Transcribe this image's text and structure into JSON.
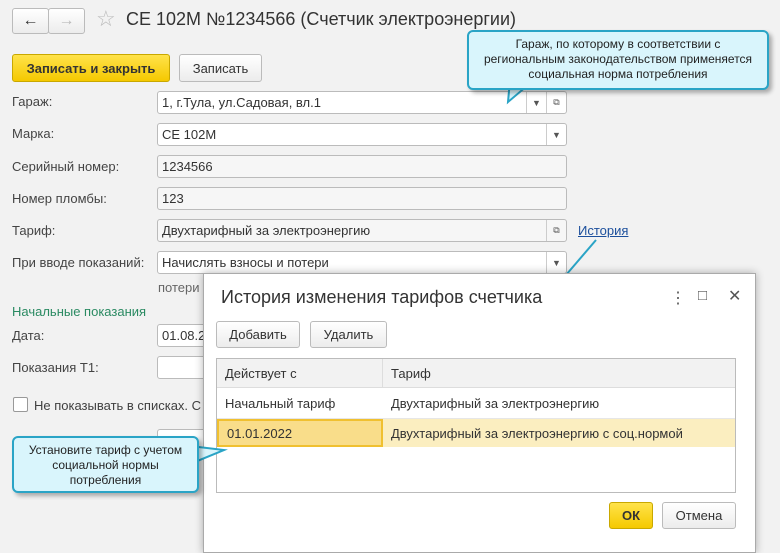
{
  "header": {
    "title": "СЕ 102М №1234566 (Счетчик электроэнергии)"
  },
  "toolbar": {
    "save_close": "Записать и закрыть",
    "save": "Записать"
  },
  "form": {
    "garage_label": "Гараж:",
    "garage_value": "1, г.Тула, ул.Садовая, вл.1",
    "brand_label": "Марка:",
    "brand_value": "СЕ 102М",
    "serial_label": "Серийный номер:",
    "serial_value": "1234566",
    "seal_label": "Номер пломбы:",
    "seal_value": "123",
    "tariff_label": "Тариф:",
    "tariff_value": "Двухтарифный за электроэнергию",
    "history_link": "История",
    "input_mode_label": "При вводе показаний:",
    "input_mode_value": "Начислять взносы и потери",
    "input_mode_note": "потери",
    "initial_section": "Начальные показания",
    "date_label": "Дата:",
    "date_value": "01.08.2",
    "t1_label": "Показания Т1:",
    "hide_checkbox": "Не показывать в списках. С"
  },
  "callouts": {
    "garage": "Гараж, по которому в соответствии с региональным законодательством применяется социальная норма потребления",
    "tariff": "Установите тариф с учетом социальной нормы потребления"
  },
  "dialog": {
    "title": "История изменения тарифов счетчика",
    "add": "Добавить",
    "delete": "Удалить",
    "columns": [
      "Действует с",
      "Тариф"
    ],
    "rows": [
      {
        "from": "Начальный тариф",
        "tariff": "Двухтарифный за электроэнергию"
      },
      {
        "from": "01.01.2022",
        "tariff": "Двухтарифный за электроэнергию с соц.нормой"
      }
    ],
    "ok": "ОК",
    "cancel": "Отмена"
  },
  "colors": {
    "accent": "#f5c900",
    "section": "#2a8a62",
    "callout_border": "#2aa4c6",
    "selected_row": "#fbeec0"
  }
}
